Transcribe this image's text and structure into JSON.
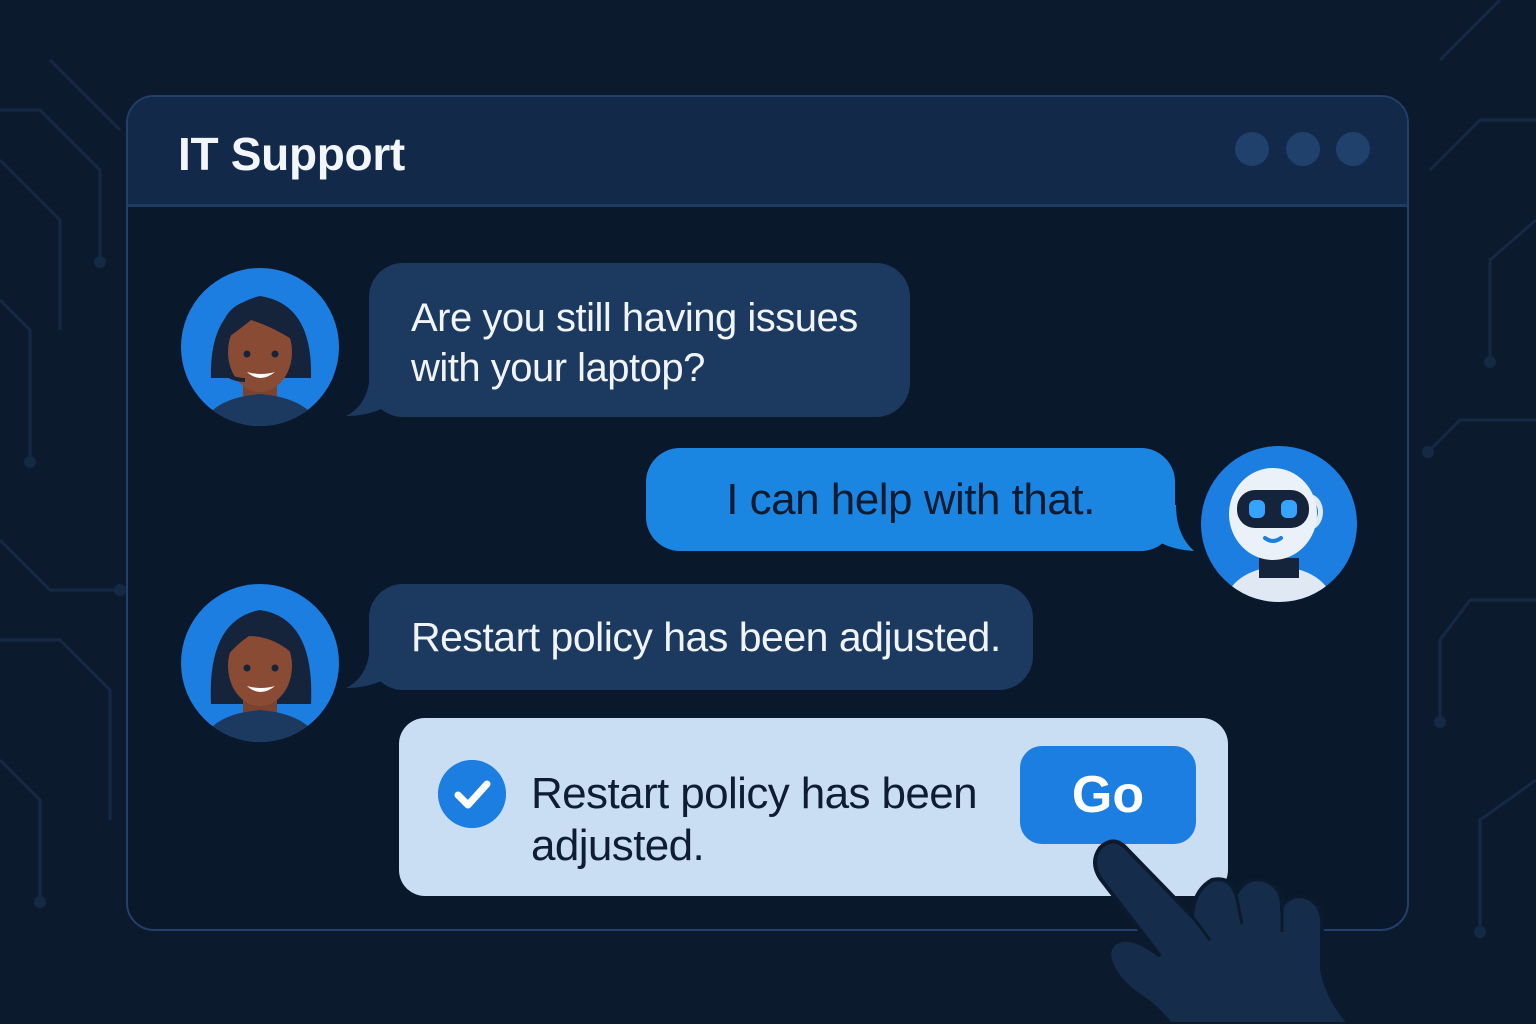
{
  "window": {
    "title": "IT Support"
  },
  "messages": [
    {
      "sender": "agent",
      "text_lines": [
        "Are you still having issues",
        "with your laptop?"
      ]
    },
    {
      "sender": "bot",
      "text": "I can help with that."
    },
    {
      "sender": "agent",
      "text": "Restart policy has been adjusted."
    }
  ],
  "notification": {
    "text_lines": [
      "Restart policy has been",
      "adjusted."
    ],
    "button_label": "Go"
  },
  "colors": {
    "background": "#0c1a2e",
    "accent": "#1c7ee0",
    "agent_bubble": "#1c3a5f",
    "bot_bubble": "#1b86e2",
    "notification_bg": "#c9ddf3"
  },
  "icons": [
    "window-dot-icon",
    "agent-avatar-icon",
    "robot-avatar-icon",
    "check-icon",
    "pointing-hand-icon"
  ]
}
